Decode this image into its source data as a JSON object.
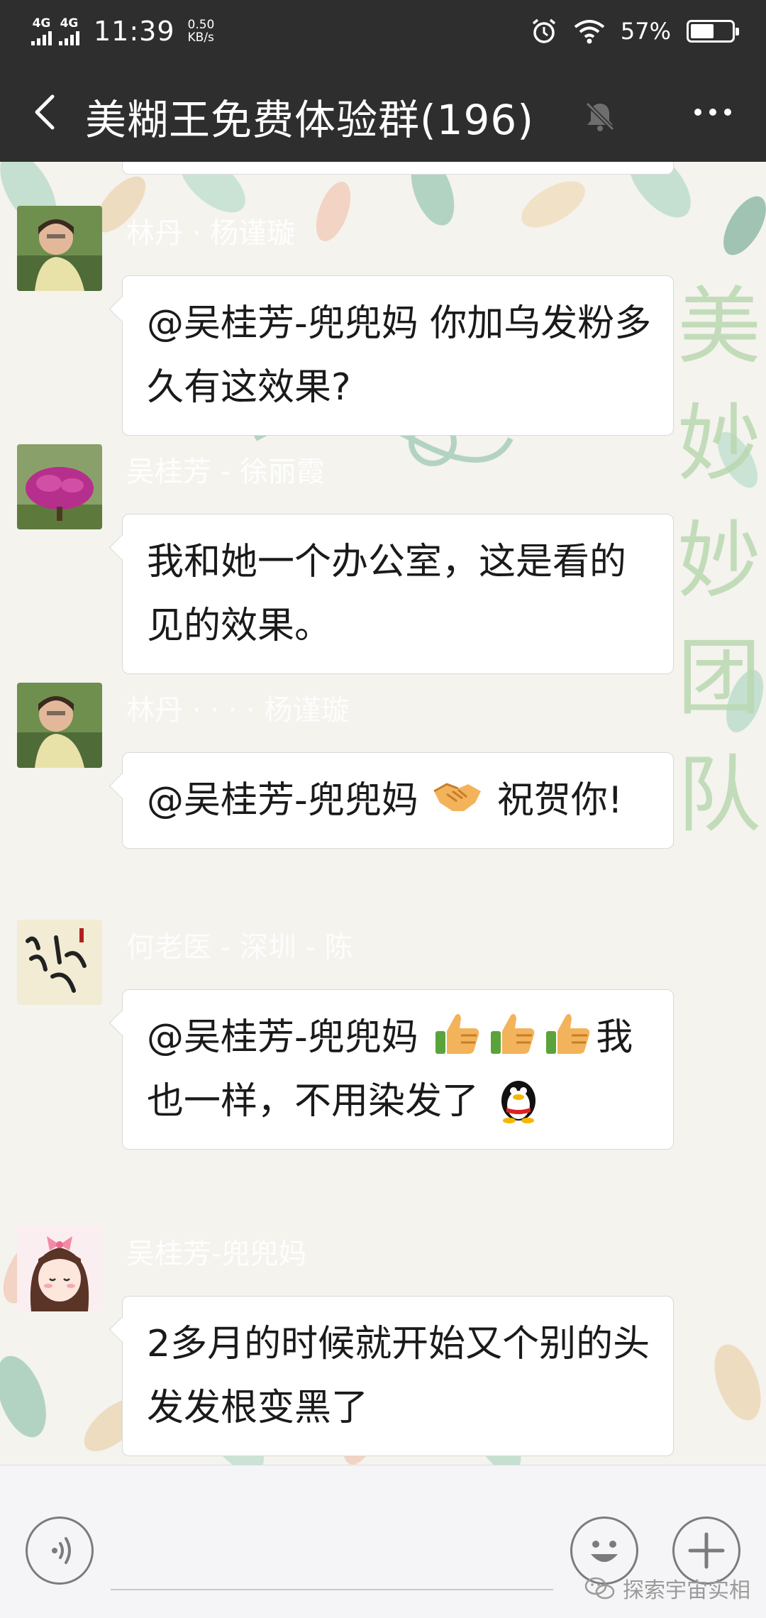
{
  "status_bar": {
    "network_1": "4G",
    "network_2": "4G",
    "time": "11:39",
    "speed_value": "0.50",
    "speed_unit": "KB/s",
    "battery_percent": "57%",
    "battery_level": 0.57
  },
  "header": {
    "title": "美糊王免费体验群(196)",
    "back_icon": "chevron-left-icon",
    "mute_icon": "bell-muted-icon",
    "more_icon": "more-dots-icon"
  },
  "background": {
    "watermark_chars": [
      "美",
      "妙",
      "妙",
      "团",
      "队"
    ]
  },
  "messages": [
    {
      "sender": "林丹 · 杨谨璇",
      "avatar": "woman-portrait-avatar",
      "parts": [
        "@吴桂芳-兜兜妈  你加乌发粉多久有这效果?"
      ]
    },
    {
      "sender": "吴桂芳 - 徐丽霞",
      "avatar": "flower-bush-avatar",
      "parts": [
        "我和她一个办公室，这是看的见的效果。"
      ]
    },
    {
      "sender": "林丹 · · · · 杨谨璇",
      "avatar": "woman-portrait-avatar",
      "parts": [
        "@吴桂芳-兜兜妈 ",
        "祝贺你!"
      ],
      "emojis": [
        "handshake-emoji"
      ]
    },
    {
      "sender": "何老医 - 深圳 - 陈",
      "avatar": "calligraphy-avatar",
      "avatar_text": "治病求",
      "parts": [
        "@吴桂芳-兜兜妈 ",
        "我也一样，不用染发了"
      ],
      "emojis": [
        "thumbs-up-emoji",
        "thumbs-up-emoji",
        "thumbs-up-emoji",
        "penguin-emoji"
      ]
    },
    {
      "sender": "吴桂芳-兜兜妈",
      "avatar": "cartoon-girl-avatar",
      "parts": [
        "2多月的时候就开始又个别的头发发根变黑了"
      ]
    }
  ],
  "input_bar": {
    "voice_icon": "voice-icon",
    "emoji_icon": "smiley-icon",
    "plus_icon": "plus-icon",
    "placeholder": ""
  },
  "watermark": {
    "text": "探索宇宙实相",
    "icon": "wechat-logo-icon"
  }
}
